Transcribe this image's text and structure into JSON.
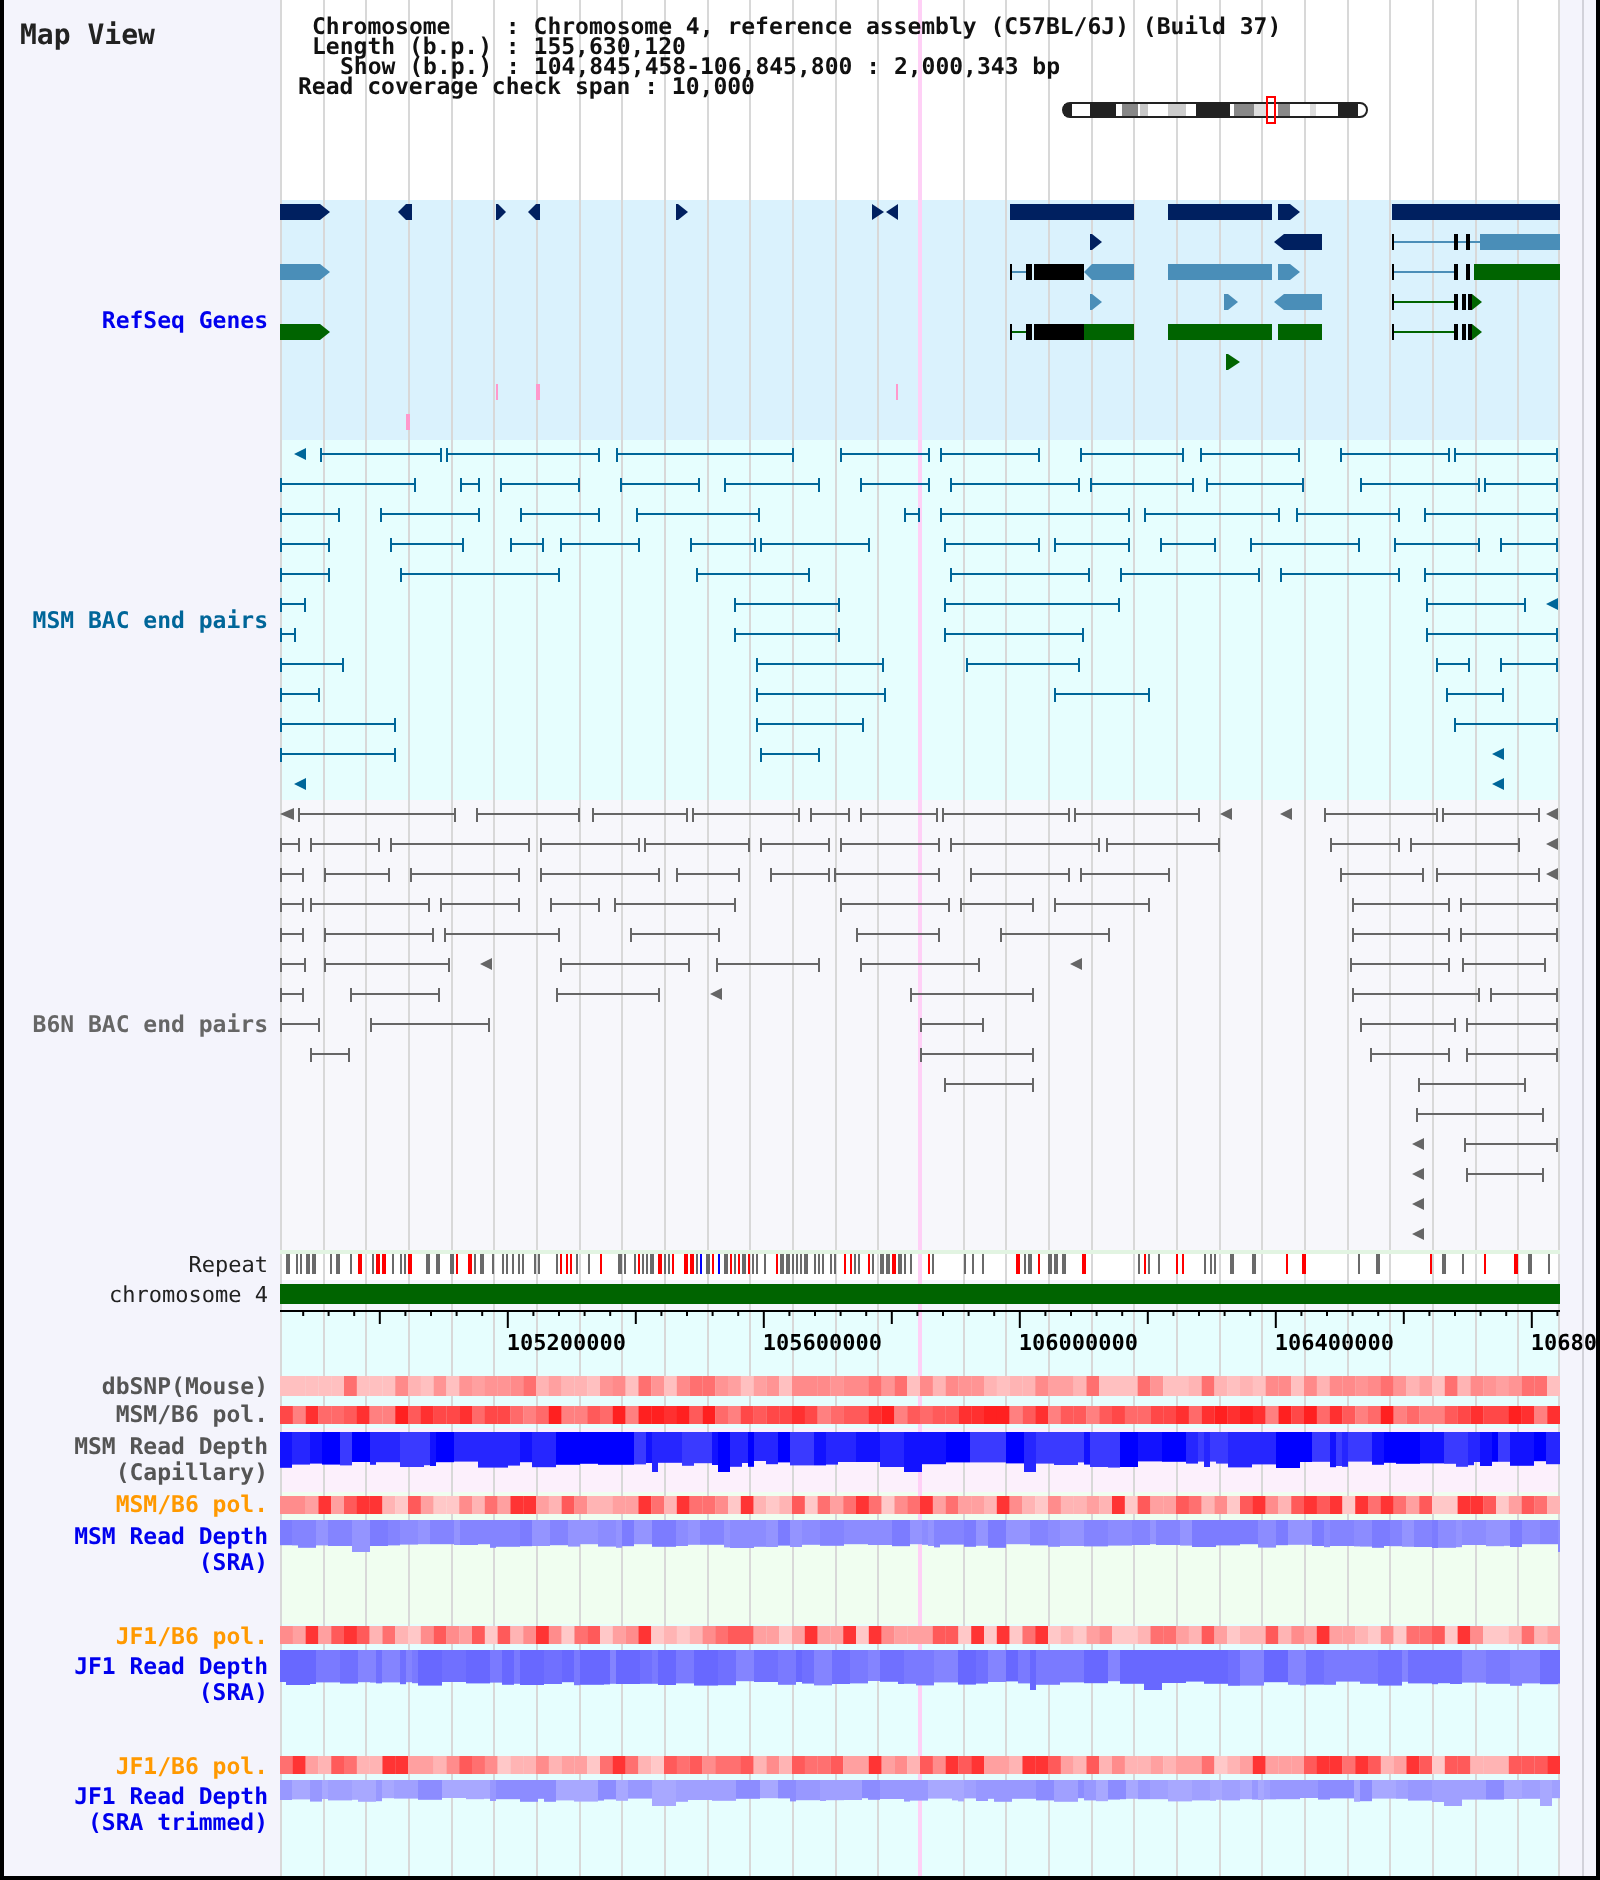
{
  "title": "Map View",
  "info": {
    "lines": [
      "Chromosome    : Chromosome 4, reference assembly (C57BL/6J) (Build 37)",
      "Length (b.p.) : 155,630,120",
      "Show (b.p.) : 104,845,458-106,845,800 : 2,000,343 bp",
      "Read coverage check span : 10,000"
    ]
  },
  "feature_tracks": [
    {
      "kind": "genes",
      "label": "RefSeq Genes",
      "color": "#0000ee"
    },
    {
      "kind": "bac_pairs",
      "label": "MSM BAC end pairs",
      "color": "#006699"
    },
    {
      "kind": "bac_pairs",
      "label": "B6N BAC end pairs",
      "color": "#666666"
    }
  ],
  "repeat_track": {
    "label": "Repeat"
  },
  "chromosome_track": {
    "label": "chromosome 4"
  },
  "ruler": {
    "labels": [
      "105200000",
      "105600000",
      "106000000",
      "106400000",
      "10680"
    ]
  },
  "data_tracks": [
    {
      "kind": "heat",
      "label": "dbSNP(Mouse)",
      "color": "#555555"
    },
    {
      "kind": "heat",
      "label": "MSM/B6 pol.",
      "color": "#555555"
    },
    {
      "kind": "depth",
      "label": "MSM Read Depth (Capillary)",
      "color": "#555555"
    },
    {
      "kind": "heat",
      "label": "MSM/B6 pol.",
      "color": "#ff9900"
    },
    {
      "kind": "depth",
      "label": "MSM Read Depth (SRA)",
      "color": "#0000ee"
    },
    {
      "kind": "heat",
      "label": "JF1/B6 pol.",
      "color": "#ff9900"
    },
    {
      "kind": "depth",
      "label": "JF1 Read Depth (SRA)",
      "color": "#0000ee"
    },
    {
      "kind": "heat",
      "label": "JF1/B6 pol.",
      "color": "#ff9900"
    },
    {
      "kind": "depth",
      "label": "JF1 Read Depth (SRA trimmed)",
      "color": "#0000ee"
    }
  ]
}
